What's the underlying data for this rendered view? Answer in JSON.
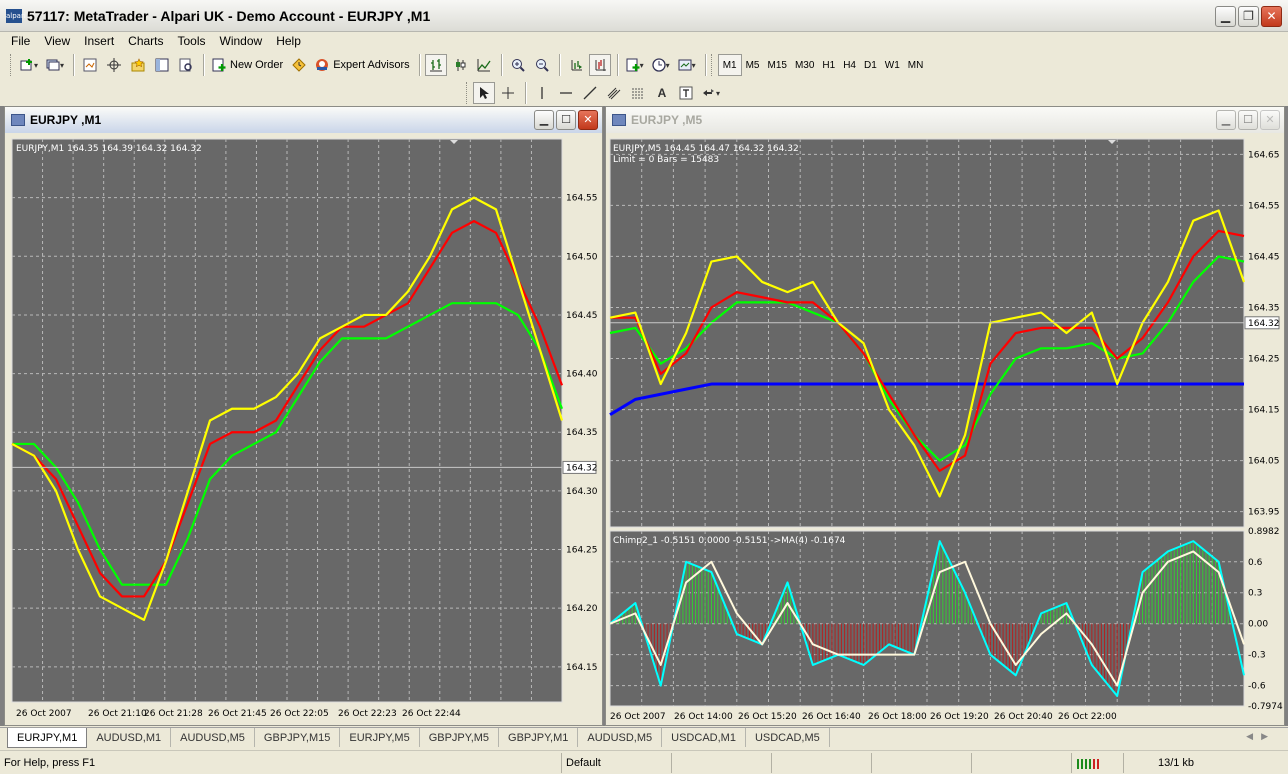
{
  "app": {
    "title": "57117: MetaTrader - Alpari UK - Demo Account - EURJPY ,M1",
    "icon_label": "alpari"
  },
  "menu": [
    "File",
    "View",
    "Insert",
    "Charts",
    "Tools",
    "Window",
    "Help"
  ],
  "toolbar": {
    "new_order": "New Order",
    "expert_advisors": "Expert Advisors",
    "timeframes": [
      "M1",
      "M5",
      "M15",
      "M30",
      "H1",
      "H4",
      "D1",
      "W1",
      "MN"
    ],
    "active_timeframe": "M1"
  },
  "windows": [
    {
      "title": "EURJPY ,M1",
      "active": true,
      "info": "EURJPY,M1  164.35 164.39 164.32 164.32",
      "price_labels": [
        "164.55",
        "164.50",
        "164.45",
        "164.40",
        "164.35",
        "164.30",
        "164.25",
        "164.20",
        "164.15"
      ],
      "current_price": "164.32",
      "time_labels": [
        "26 Oct 2007",
        "26 Oct 21:10",
        "26 Oct 21:28",
        "26 Oct 21:45",
        "26 Oct 22:05",
        "26 Oct 22:23",
        "26 Oct 22:44"
      ]
    },
    {
      "title": "EURJPY ,M5",
      "active": false,
      "info": "EURJPY,M5  164.45 164.47 164.32 164.32",
      "info2": "Limit = 0 Bars = 15483",
      "price_labels": [
        "164.65",
        "164.55",
        "164.45",
        "164.35",
        "164.25",
        "164.15",
        "164.05",
        "163.95"
      ],
      "current_price": "164.32",
      "indicator_info": "Chimp2_1 -0.5151 0.0000 -0.5151  ->MA(4) -0.1674",
      "indicator_labels": [
        "0.8982",
        "0.6",
        "0.3",
        "0.00",
        "-0.3",
        "-0.6",
        "-0.7974"
      ],
      "time_labels": [
        "26 Oct 2007",
        "26 Oct 14:00",
        "26 Oct 15:20",
        "26 Oct 16:40",
        "26 Oct 18:00",
        "26 Oct 19:20",
        "26 Oct 20:40",
        "26 Oct 22:00"
      ]
    }
  ],
  "tabs": [
    "EURJPY,M1",
    "AUDUSD,M1",
    "AUDUSD,M5",
    "GBPJPY,M15",
    "EURJPY,M5",
    "GBPJPY,M5",
    "GBPJPY,M1",
    "AUDUSD,M5",
    "USDCAD,M1",
    "USDCAD,M5"
  ],
  "active_tab": "EURJPY,M1",
  "status": {
    "help": "For Help, press F1",
    "profile": "Default",
    "traffic": "13/1 kb"
  },
  "colors": {
    "chart_bg": "#686868",
    "grid": "#b8b8b8",
    "candle": "#33cc33",
    "ma_fast": "#ffff00",
    "ma_mid": "#ff0000",
    "ma_slow": "#00ff00",
    "ma_long": "#0000ff",
    "osc_main": "#00ffff",
    "osc_signal": "#fff8dc",
    "hist_pos": "#33cc33",
    "hist_neg": "#b22222"
  },
  "chart_data": [
    {
      "type": "line",
      "title": "EURJPY,M1",
      "ylim": [
        164.12,
        164.6
      ],
      "x": [
        0,
        4,
        8,
        12,
        16,
        20,
        24,
        28,
        32,
        36,
        40,
        44,
        48,
        52,
        56,
        60,
        64,
        68,
        72,
        76,
        80,
        84,
        88,
        92,
        96,
        100
      ],
      "series": [
        {
          "values": [
            164.34,
            164.33,
            164.3,
            164.25,
            164.21,
            164.2,
            164.19,
            164.24,
            164.3,
            164.36,
            164.37,
            164.37,
            164.38,
            164.4,
            164.43,
            164.44,
            164.45,
            164.45,
            164.47,
            164.5,
            164.54,
            164.55,
            164.54,
            164.48,
            164.42,
            164.36
          ]
        },
        {
          "values": [
            164.34,
            164.33,
            164.31,
            164.27,
            164.23,
            164.21,
            164.21,
            164.24,
            164.29,
            164.34,
            164.35,
            164.35,
            164.36,
            164.39,
            164.42,
            164.44,
            164.44,
            164.45,
            164.46,
            164.49,
            164.52,
            164.53,
            164.52,
            164.48,
            164.44,
            164.39
          ]
        },
        {
          "values": [
            164.34,
            164.34,
            164.32,
            164.29,
            164.25,
            164.22,
            164.22,
            164.22,
            164.26,
            164.31,
            164.33,
            164.34,
            164.35,
            164.38,
            164.41,
            164.43,
            164.43,
            164.43,
            164.44,
            164.45,
            164.46,
            164.46,
            164.46,
            164.45,
            164.42,
            164.37
          ]
        }
      ]
    },
    {
      "type": "line",
      "title": "EURJPY,M5",
      "ylim": [
        163.92,
        164.68
      ],
      "x": [
        0,
        4,
        8,
        12,
        16,
        20,
        24,
        28,
        32,
        36,
        40,
        44,
        48,
        52,
        56,
        60,
        64,
        68,
        72,
        76,
        80,
        84,
        88,
        92,
        96,
        100
      ],
      "series": [
        {
          "values": [
            164.33,
            164.34,
            164.2,
            164.3,
            164.44,
            164.45,
            164.4,
            164.38,
            164.4,
            164.32,
            164.28,
            164.15,
            164.08,
            163.98,
            164.1,
            164.32,
            164.33,
            164.34,
            164.3,
            164.34,
            164.2,
            164.32,
            164.4,
            164.52,
            164.54,
            164.4
          ]
        },
        {
          "values": [
            164.33,
            164.33,
            164.22,
            164.26,
            164.35,
            164.38,
            164.37,
            164.36,
            164.36,
            164.32,
            164.26,
            164.18,
            164.1,
            164.03,
            164.06,
            164.24,
            164.3,
            164.31,
            164.31,
            164.31,
            164.25,
            164.29,
            164.36,
            164.45,
            164.5,
            164.49
          ]
        },
        {
          "values": [
            164.3,
            164.31,
            164.24,
            164.27,
            164.32,
            164.36,
            164.36,
            164.36,
            164.34,
            164.32,
            164.26,
            164.17,
            164.1,
            164.05,
            164.08,
            164.18,
            164.25,
            164.27,
            164.27,
            164.28,
            164.25,
            164.26,
            164.32,
            164.4,
            164.45,
            164.44
          ]
        },
        {
          "values": [
            164.14,
            164.17,
            164.18,
            164.19,
            164.2,
            164.2,
            164.2,
            164.2,
            164.2,
            164.2,
            164.2,
            164.2,
            164.2,
            164.2,
            164.2,
            164.2,
            164.2,
            164.2,
            164.2,
            164.2,
            164.2,
            164.2,
            164.2,
            164.2,
            164.2,
            164.2
          ]
        }
      ]
    },
    {
      "type": "bar",
      "title": "Chimp2_1",
      "ylim": [
        -0.7974,
        0.8982
      ],
      "x": [
        0,
        4,
        8,
        12,
        16,
        20,
        24,
        28,
        32,
        36,
        40,
        44,
        48,
        52,
        56,
        60,
        64,
        68,
        72,
        76,
        80,
        84,
        88,
        92,
        96,
        100
      ],
      "series": [
        {
          "values": [
            0.0,
            0.2,
            -0.6,
            0.6,
            0.5,
            -0.1,
            -0.2,
            0.4,
            -0.4,
            -0.3,
            -0.4,
            -0.2,
            -0.3,
            0.8,
            0.3,
            -0.3,
            -0.5,
            0.1,
            0.2,
            -0.4,
            -0.7,
            0.5,
            0.7,
            0.8,
            0.6,
            -0.5
          ]
        },
        {
          "values": [
            0.0,
            0.1,
            -0.4,
            0.4,
            0.6,
            0.1,
            -0.2,
            0.2,
            -0.2,
            -0.3,
            -0.3,
            -0.3,
            -0.3,
            0.5,
            0.6,
            0.0,
            -0.4,
            -0.1,
            0.1,
            -0.2,
            -0.6,
            0.3,
            0.6,
            0.7,
            0.5,
            -0.2
          ]
        }
      ]
    }
  ]
}
